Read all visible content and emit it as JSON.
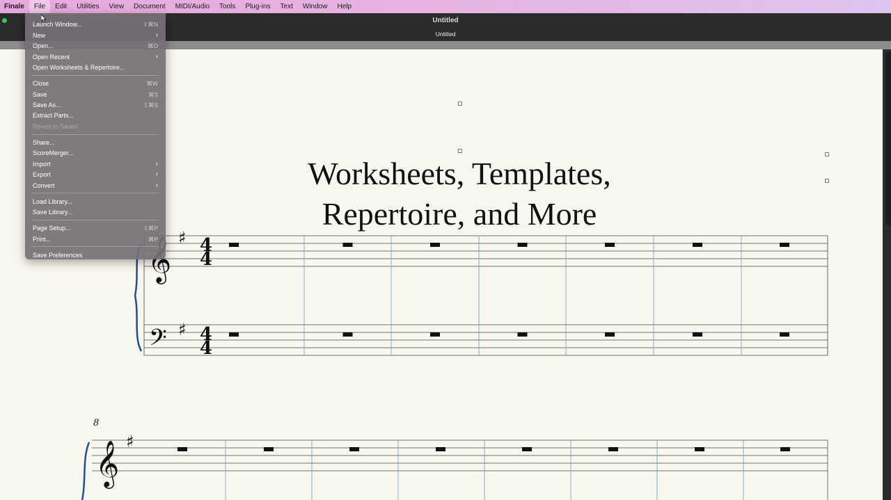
{
  "menubar": {
    "items": [
      "Finale",
      "File",
      "Edit",
      "Utilities",
      "View",
      "Document",
      "MIDI/Audio",
      "Tools",
      "Plug-ins",
      "Text",
      "Window",
      "Help"
    ]
  },
  "window": {
    "title": "Untitled",
    "subtitle": "Untitled"
  },
  "score": {
    "title_line1": "Worksheets, Templates,",
    "title_line2": "Repertoire, and More",
    "time_signature_top": "4",
    "time_signature_bottom": "4",
    "measure_number": "8"
  },
  "file_menu": {
    "items": [
      {
        "label": "Launch Window...",
        "shortcut": "⇧⌘N"
      },
      {
        "label": "New",
        "submenu": true
      },
      {
        "label": "Open...",
        "shortcut": "⌘O"
      },
      {
        "label": "Open Recent",
        "submenu": true
      },
      {
        "label": "Open Worksheets & Repertoire..."
      },
      {
        "label": "Close",
        "shortcut": "⌘W"
      },
      {
        "label": "Save",
        "shortcut": "⌘S"
      },
      {
        "label": "Save As...",
        "shortcut": "⇧⌘S"
      },
      {
        "label": "Extract Parts..."
      },
      {
        "label": "Revert to Saved",
        "disabled": true
      },
      {
        "label": "Share..."
      },
      {
        "label": "ScoreMerger..."
      },
      {
        "label": "Import",
        "submenu": true
      },
      {
        "label": "Export",
        "submenu": true
      },
      {
        "label": "Convert",
        "submenu": true
      },
      {
        "label": "Load Library..."
      },
      {
        "label": "Save Library..."
      },
      {
        "label": "Page Setup...",
        "shortcut": "⇧⌘P"
      },
      {
        "label": "Print...",
        "shortcut": "⌘P"
      },
      {
        "label": "Save Preferences"
      }
    ]
  },
  "colors": {
    "menubar": "#e6a9dd",
    "page": "#f8f7ef",
    "barline": "#6f9bd8",
    "brace": "#1f4f8f"
  }
}
